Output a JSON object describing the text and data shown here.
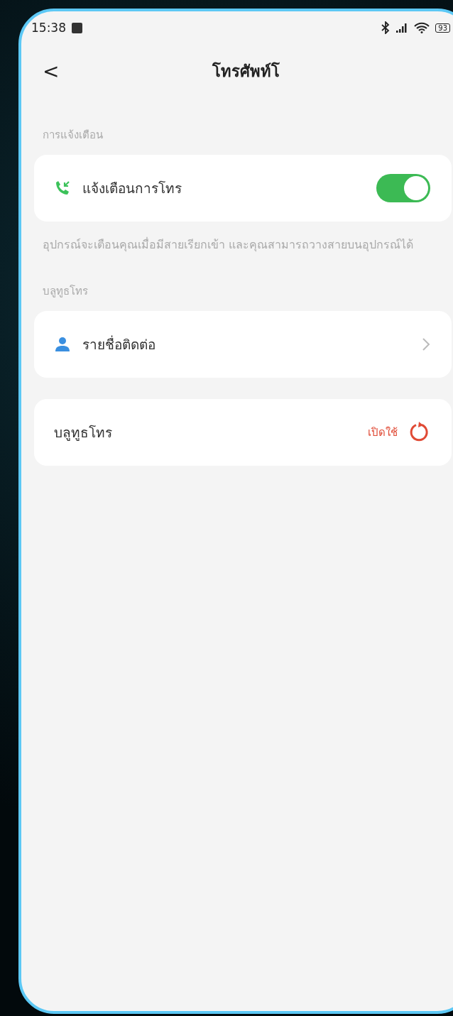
{
  "status_bar": {
    "time": "15:38",
    "battery": "93"
  },
  "header": {
    "back": "<",
    "title": "โทรศัพท์โ"
  },
  "sections": [
    {
      "label": "การแจ้งเตือน",
      "rows": [
        {
          "kind": "toggle",
          "label": "แจ้งเตือนการโทร",
          "on": true
        }
      ],
      "note": "อุปกรณ์จะเตือนคุณเมื่อมีสายเรียกเข้า และคุณสามารถวางสายบนอุปกรณ์ได้"
    },
    {
      "label": "บลูทูธโทร",
      "rows": [
        {
          "kind": "link",
          "label": "รายชื่อติดต่อ"
        }
      ]
    },
    {
      "rows": [
        {
          "kind": "action",
          "label": "บลูทูธโทร",
          "action": "เปิดใช้"
        }
      ]
    }
  ]
}
